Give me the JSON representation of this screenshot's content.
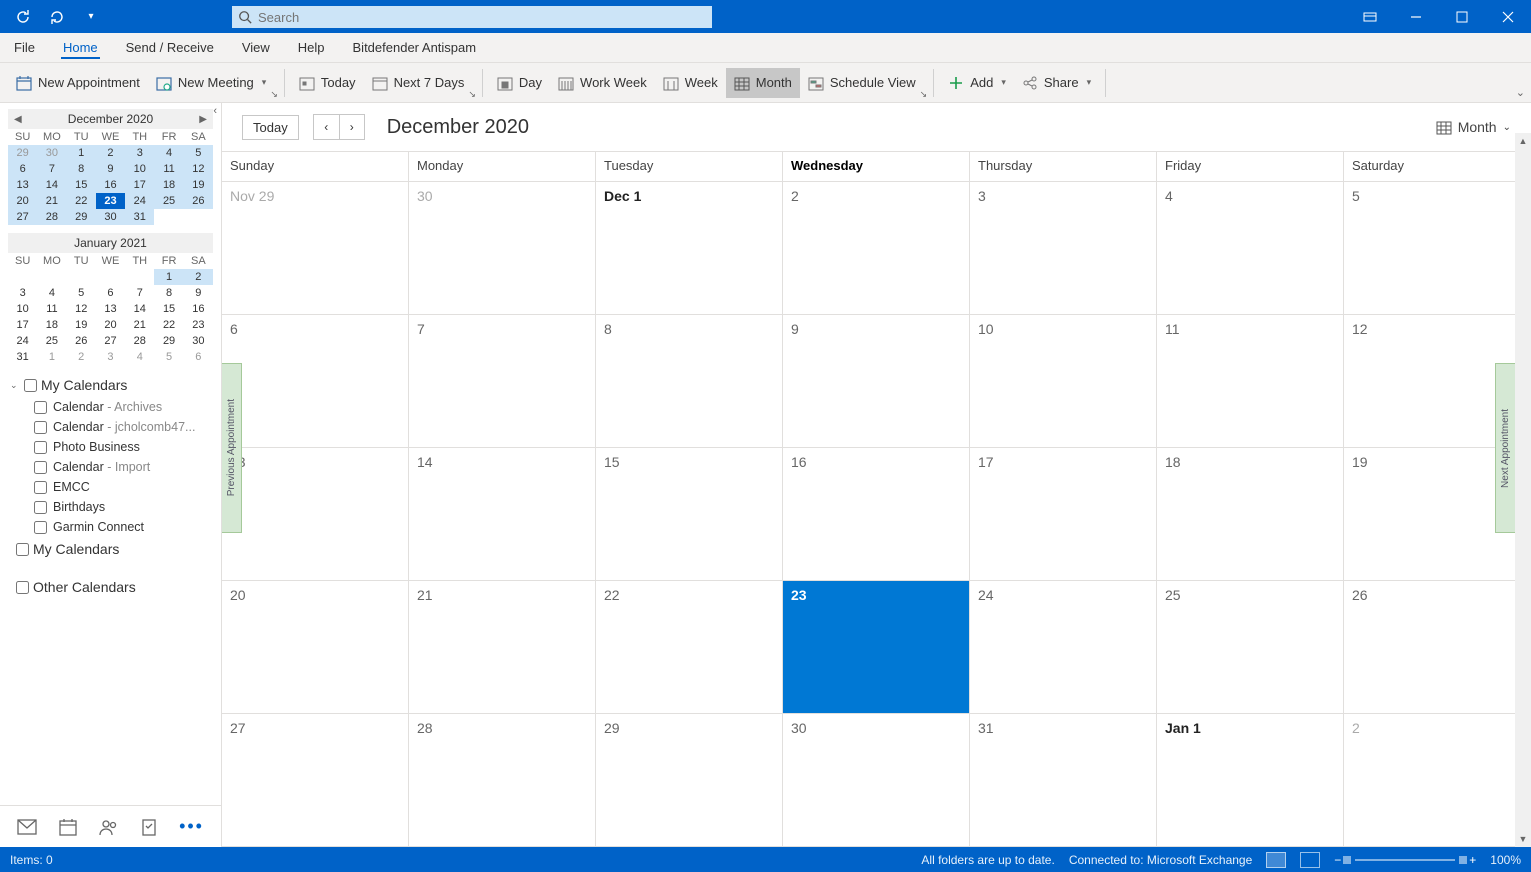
{
  "titlebar": {
    "search_placeholder": "Search"
  },
  "menu": {
    "items": [
      "File",
      "Home",
      "Send / Receive",
      "View",
      "Help",
      "Bitdefender Antispam"
    ],
    "active": "Home"
  },
  "ribbon": {
    "new_appointment": "New Appointment",
    "new_meeting": "New Meeting",
    "today": "Today",
    "next7": "Next 7 Days",
    "day": "Day",
    "work_week": "Work Week",
    "week": "Week",
    "month": "Month",
    "schedule_view": "Schedule View",
    "add": "Add",
    "share": "Share"
  },
  "sidebar": {
    "minical1": {
      "title": "December 2020",
      "dow": [
        "SU",
        "MO",
        "TU",
        "WE",
        "TH",
        "FR",
        "SA"
      ],
      "days": [
        {
          "d": "29",
          "other": true,
          "hl": true
        },
        {
          "d": "30",
          "other": true,
          "hl": true
        },
        {
          "d": "1",
          "hl": true
        },
        {
          "d": "2",
          "hl": true
        },
        {
          "d": "3",
          "hl": true
        },
        {
          "d": "4",
          "hl": true
        },
        {
          "d": "5",
          "hl": true
        },
        {
          "d": "6",
          "hl": true
        },
        {
          "d": "7",
          "hl": true
        },
        {
          "d": "8",
          "hl": true
        },
        {
          "d": "9",
          "hl": true
        },
        {
          "d": "10",
          "hl": true
        },
        {
          "d": "11",
          "hl": true
        },
        {
          "d": "12",
          "hl": true
        },
        {
          "d": "13",
          "hl": true
        },
        {
          "d": "14",
          "hl": true
        },
        {
          "d": "15",
          "hl": true
        },
        {
          "d": "16",
          "hl": true
        },
        {
          "d": "17",
          "hl": true
        },
        {
          "d": "18",
          "hl": true
        },
        {
          "d": "19",
          "hl": true
        },
        {
          "d": "20",
          "hl": true
        },
        {
          "d": "21",
          "hl": true
        },
        {
          "d": "22",
          "hl": true
        },
        {
          "d": "23",
          "today": true
        },
        {
          "d": "24",
          "hl": true
        },
        {
          "d": "25",
          "hl": true
        },
        {
          "d": "26",
          "hl": true
        },
        {
          "d": "27",
          "hl": true
        },
        {
          "d": "28",
          "hl": true
        },
        {
          "d": "29",
          "hl": true
        },
        {
          "d": "30",
          "hl": true
        },
        {
          "d": "31",
          "hl": true
        },
        {
          "d": "",
          "empty": true
        },
        {
          "d": "",
          "empty": true
        }
      ]
    },
    "minical2": {
      "title": "January 2021",
      "dow": [
        "SU",
        "MO",
        "TU",
        "WE",
        "TH",
        "FR",
        "SA"
      ],
      "days": [
        {
          "d": "",
          "empty": true
        },
        {
          "d": "",
          "empty": true
        },
        {
          "d": "",
          "empty": true
        },
        {
          "d": "",
          "empty": true
        },
        {
          "d": "",
          "empty": true
        },
        {
          "d": "1",
          "hl": true
        },
        {
          "d": "2",
          "hl": true
        },
        {
          "d": "3"
        },
        {
          "d": "4"
        },
        {
          "d": "5"
        },
        {
          "d": "6"
        },
        {
          "d": "7"
        },
        {
          "d": "8"
        },
        {
          "d": "9"
        },
        {
          "d": "10"
        },
        {
          "d": "11"
        },
        {
          "d": "12"
        },
        {
          "d": "13"
        },
        {
          "d": "14"
        },
        {
          "d": "15"
        },
        {
          "d": "16"
        },
        {
          "d": "17"
        },
        {
          "d": "18"
        },
        {
          "d": "19"
        },
        {
          "d": "20"
        },
        {
          "d": "21"
        },
        {
          "d": "22"
        },
        {
          "d": "23"
        },
        {
          "d": "24"
        },
        {
          "d": "25"
        },
        {
          "d": "26"
        },
        {
          "d": "27"
        },
        {
          "d": "28"
        },
        {
          "d": "29"
        },
        {
          "d": "30"
        },
        {
          "d": "31"
        },
        {
          "d": "1",
          "other": true
        },
        {
          "d": "2",
          "other": true
        },
        {
          "d": "3",
          "other": true
        },
        {
          "d": "4",
          "other": true
        },
        {
          "d": "5",
          "other": true
        },
        {
          "d": "6",
          "other": true
        }
      ]
    },
    "group1_title": "My Calendars",
    "calendars": [
      {
        "name": "Calendar",
        "sub": " - Archives"
      },
      {
        "name": "Calendar",
        "sub": " - jcholcomb47..."
      },
      {
        "name": "Photo Business",
        "sub": ""
      },
      {
        "name": "Calendar",
        "sub": " - Import"
      },
      {
        "name": "EMCC",
        "sub": ""
      },
      {
        "name": "Birthdays",
        "sub": ""
      },
      {
        "name": "Garmin Connect",
        "sub": ""
      }
    ],
    "group2_title": "My Calendars",
    "group3_title": "Other Calendars"
  },
  "calendar": {
    "today_btn": "Today",
    "title": "December 2020",
    "view_selector": "Month",
    "dow": [
      "Sunday",
      "Monday",
      "Tuesday",
      "Wednesday",
      "Thursday",
      "Friday",
      "Saturday"
    ],
    "today_dow_index": 3,
    "weeks": [
      [
        {
          "l": "Nov 29",
          "other": true
        },
        {
          "l": "30",
          "other": true
        },
        {
          "l": "Dec 1",
          "bold": true
        },
        {
          "l": "2"
        },
        {
          "l": "3"
        },
        {
          "l": "4"
        },
        {
          "l": "5"
        }
      ],
      [
        {
          "l": "6"
        },
        {
          "l": "7"
        },
        {
          "l": "8"
        },
        {
          "l": "9"
        },
        {
          "l": "10"
        },
        {
          "l": "11"
        },
        {
          "l": "12"
        }
      ],
      [
        {
          "l": "13"
        },
        {
          "l": "14"
        },
        {
          "l": "15"
        },
        {
          "l": "16"
        },
        {
          "l": "17"
        },
        {
          "l": "18"
        },
        {
          "l": "19"
        }
      ],
      [
        {
          "l": "20"
        },
        {
          "l": "21"
        },
        {
          "l": "22"
        },
        {
          "l": "23",
          "today": true
        },
        {
          "l": "24"
        },
        {
          "l": "25"
        },
        {
          "l": "26"
        }
      ],
      [
        {
          "l": "27"
        },
        {
          "l": "28"
        },
        {
          "l": "29"
        },
        {
          "l": "30"
        },
        {
          "l": "31"
        },
        {
          "l": "Jan 1",
          "bold": true
        },
        {
          "l": "2",
          "other": true
        }
      ]
    ],
    "prev_appt": "Previous Appointment",
    "next_appt": "Next Appointment"
  },
  "statusbar": {
    "items": "Items: 0",
    "folders": "All folders are up to date.",
    "connected": "Connected to: Microsoft Exchange",
    "zoom": "100%"
  }
}
